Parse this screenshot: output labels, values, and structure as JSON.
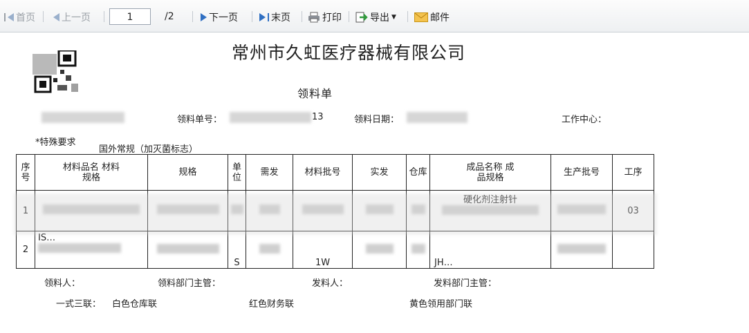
{
  "toolbar": {
    "first": "首页",
    "prev": "上一页",
    "page_value": "1",
    "page_total": "/2",
    "next": "下一页",
    "last": "末页",
    "print": "打印",
    "export": "导出",
    "mail": "邮件"
  },
  "doc": {
    "company": "常州市久虹医疗器械有限公司",
    "form_title": "领料单",
    "order_no_label": "领料单号：",
    "order_no_tail": "13",
    "date_label": "领料日期：",
    "workcenter_label": "工作中心：",
    "special_label": "*特殊要求",
    "special_value": "国外常规（加灭菌标志）"
  },
  "table": {
    "headers": [
      "序号",
      "材料品名 材料规格",
      "规格",
      "单位",
      "需发",
      "材料批号",
      "实发",
      "仓库",
      "成品名称 成品规格",
      "生产批号",
      "工序"
    ],
    "rows": [
      {
        "seq": "1",
        "product": "硬化剂注射针",
        "process": "03"
      },
      {
        "seq": "2",
        "material_note": "IS…",
        "unit": "S",
        "batch_tail": "1W",
        "product_code": "JH…"
      }
    ]
  },
  "footer": {
    "receiver": "领料人：",
    "recv_dept_mgr": "领料部门主管：",
    "issuer": "发料人：",
    "issue_dept_mgr": "发料部门主管：",
    "copies": "一式三联：",
    "white": "白色仓库联",
    "red": "红色财务联",
    "yellow": "黄色领用部门联"
  }
}
